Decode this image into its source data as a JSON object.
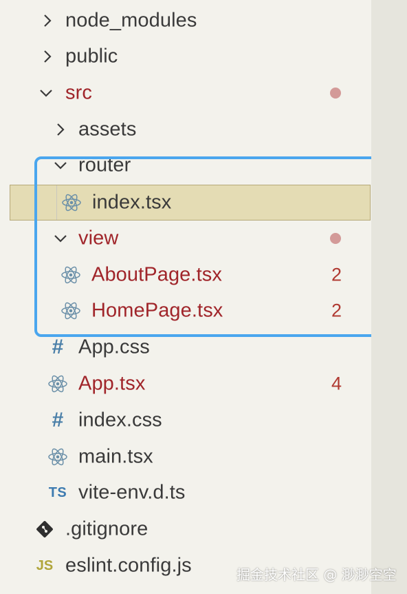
{
  "explorer": {
    "items": [
      {
        "label": "node_modules"
      },
      {
        "label": "public"
      },
      {
        "label": "src"
      },
      {
        "label": "assets"
      },
      {
        "label": "router"
      },
      {
        "label": "index.tsx"
      },
      {
        "label": "view"
      },
      {
        "label": "AboutPage.tsx",
        "badge": "2"
      },
      {
        "label": "HomePage.tsx",
        "badge": "2"
      },
      {
        "label": "App.css"
      },
      {
        "label": "App.tsx",
        "badge": "4"
      },
      {
        "label": "index.css"
      },
      {
        "label": "main.tsx"
      },
      {
        "label": "vite-env.d.ts"
      },
      {
        "label": ".gitignore"
      },
      {
        "label": "eslint.config.js"
      }
    ],
    "icon_text": {
      "hash": "#",
      "ts": "TS",
      "js": "JS"
    }
  },
  "colors": {
    "error_text": "#a0252a",
    "modified_dot": "#d39a98",
    "highlight_border": "#4aa6ee",
    "selected_bg": "#e4dcb4"
  },
  "watermark": "掘金技术社区 @ 渺渺空空"
}
